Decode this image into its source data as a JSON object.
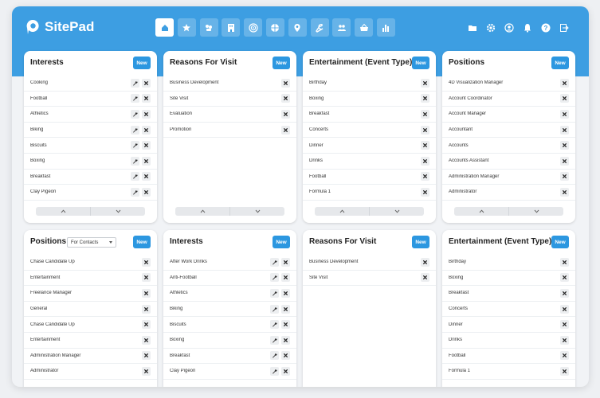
{
  "app": {
    "name": "SitePad",
    "accent": "#3d9ee2",
    "button_color": "#2c97e0"
  },
  "nav": {
    "icons": [
      "home-icon",
      "star-icon",
      "handshake-icon",
      "building-icon",
      "target-icon",
      "ball-icon",
      "location-pin-icon",
      "tools-icon",
      "people-icon",
      "basket-icon",
      "chart-icon"
    ],
    "active": 0
  },
  "header_right": {
    "icons": [
      "folder-icon",
      "gear-icon",
      "user-icon",
      "bell-icon",
      "help-icon",
      "logout-icon"
    ]
  },
  "top_cards": [
    {
      "title": "Interests",
      "new_label": "New",
      "edit": true,
      "items": [
        "Cooking",
        "Football",
        "Athletics",
        "Biking",
        "Biscuits",
        "Boxing",
        "Breakfast",
        "Clay Pigeon"
      ]
    },
    {
      "title": "Reasons For Visit",
      "new_label": "New",
      "edit": false,
      "items": [
        "Business Development",
        "Site Visit",
        "Evaluation",
        "Promotion"
      ]
    },
    {
      "title": "Entertainment (Event Type)",
      "new_label": "New",
      "edit": false,
      "items": [
        "Birthday",
        "Boxing",
        "Breakfast",
        "Concerts",
        "Dinner",
        "Drinks",
        "Football",
        "Formula 1"
      ]
    },
    {
      "title": "Positions",
      "new_label": "New",
      "edit": false,
      "items": [
        "4D Visualization Manager",
        "Account Coordinator",
        "Account Manager",
        "Accountant",
        "Accounts",
        "Accounts Assistant",
        "Administration Manager",
        "Administrator"
      ]
    }
  ],
  "bottom_cards": [
    {
      "title": "Positions",
      "new_label": "New",
      "edit": false,
      "select_value": "For Contacts",
      "items": [
        "Chase Candidate Up",
        "Entertainment",
        "Freelance Manager",
        "General",
        "Chase Candidate Up",
        "Entertainment",
        "Administration Manager",
        "Administrator"
      ]
    },
    {
      "title": "Interests",
      "new_label": "New",
      "edit": true,
      "items": [
        "After Work Drinks",
        "Anti-Football",
        "Athletics",
        "Biking",
        "Biscuits",
        "Boxing",
        "Breakfast",
        "Clay Pigeon"
      ]
    },
    {
      "title": "Reasons For Visit",
      "new_label": "New",
      "edit": false,
      "items": [
        "Business Development",
        "Site Visit"
      ]
    },
    {
      "title": "Entertainment (Event Type)",
      "new_label": "New",
      "edit": false,
      "items": [
        "Birthday",
        "Boxing",
        "Breakfast",
        "Concerts",
        "Dinner",
        "Drinks",
        "Football",
        "Formula 1"
      ]
    }
  ]
}
